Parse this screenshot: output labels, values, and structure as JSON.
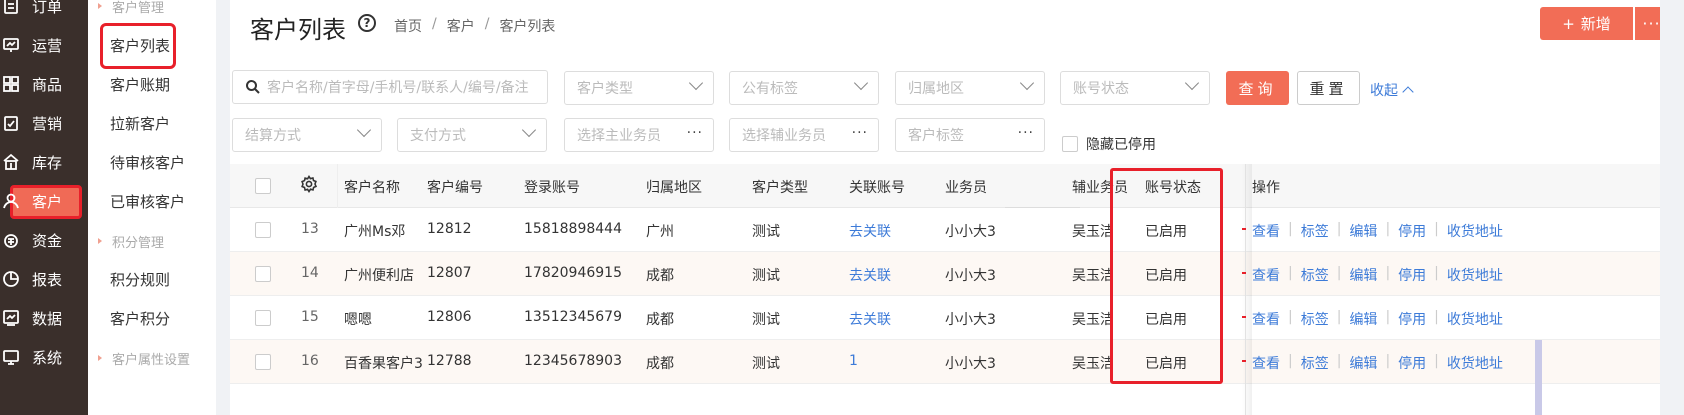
{
  "nav": {
    "items": [
      {
        "label": "订单",
        "icon": "order-icon"
      },
      {
        "label": "运营",
        "icon": "operation-icon"
      },
      {
        "label": "商品",
        "icon": "product-icon"
      },
      {
        "label": "营销",
        "icon": "marketing-icon"
      },
      {
        "label": "库存",
        "icon": "inventory-icon"
      },
      {
        "label": "客户",
        "icon": "customer-icon"
      },
      {
        "label": "资金",
        "icon": "money-icon"
      },
      {
        "label": "报表",
        "icon": "report-icon"
      },
      {
        "label": "数据",
        "icon": "data-icon"
      },
      {
        "label": "系统",
        "icon": "system-icon"
      }
    ],
    "active": "客户"
  },
  "submenu": {
    "groups": [
      "客户管理",
      "积分管理",
      "客户属性设置"
    ],
    "items": [
      "客户列表",
      "客户账期",
      "拉新客户",
      "待审核客户",
      "已审核客户",
      "积分规则",
      "客户积分"
    ],
    "active": "客户列表"
  },
  "header": {
    "title": "客户列表",
    "breadcrumb": [
      "首页",
      "客户",
      "客户列表"
    ],
    "new_label": "新增",
    "more_label": "···"
  },
  "filters": {
    "search_placeholder": "客户名称/首字母/手机号/联系人/编号/备注",
    "customer_type": "客户类型",
    "public_tag": "公有标签",
    "region": "归属地区",
    "account_status": "账号状态",
    "settlement": "结算方式",
    "payment": "支付方式",
    "main_salesman": "选择主业务员",
    "assist_salesman": "选择辅业务员",
    "customer_tag": "客户标签",
    "hide_disabled": "隐藏已停用",
    "query_label": "查询",
    "reset_label": "重置",
    "collapse_label": "收起"
  },
  "table": {
    "columns": [
      "客户名称",
      "客户编号",
      "登录账号",
      "归属地区",
      "客户类型",
      "关联账号",
      "业务员",
      "辅业务员",
      "账号状态",
      "操作"
    ],
    "rows": [
      {
        "no": "13",
        "name": "广州Ms邓",
        "code": "12812",
        "account": "15818898444",
        "region": "广州",
        "type": "测试",
        "linked": "去关联",
        "salesman": "小小大3",
        "assist": "吴玉洁",
        "status": "已启用"
      },
      {
        "no": "14",
        "name": "广州便利店",
        "code": "12807",
        "account": "17820946915",
        "region": "成都",
        "type": "测试",
        "linked": "去关联",
        "salesman": "小小大3",
        "assist": "吴玉洁",
        "status": "已启用"
      },
      {
        "no": "15",
        "name": "嗯嗯",
        "code": "12806",
        "account": "13512345679",
        "region": "成都",
        "type": "测试",
        "linked": "去关联",
        "salesman": "小小大3",
        "assist": "吴玉洁",
        "status": "已启用"
      },
      {
        "no": "16",
        "name": "百香果客户3",
        "code": "12788",
        "account": "12345678903",
        "region": "成都",
        "type": "测试",
        "linked": "1",
        "salesman": "小小大3",
        "assist": "吴玉洁",
        "status": "已启用"
      }
    ],
    "ops": [
      "查看",
      "标签",
      "编辑",
      "停用",
      "收货地址"
    ]
  },
  "colors": {
    "accent": "#f26d56",
    "link": "#3d7bd8",
    "nav_bg": "#3a2f2b",
    "highlight_red": "#e8202a"
  }
}
